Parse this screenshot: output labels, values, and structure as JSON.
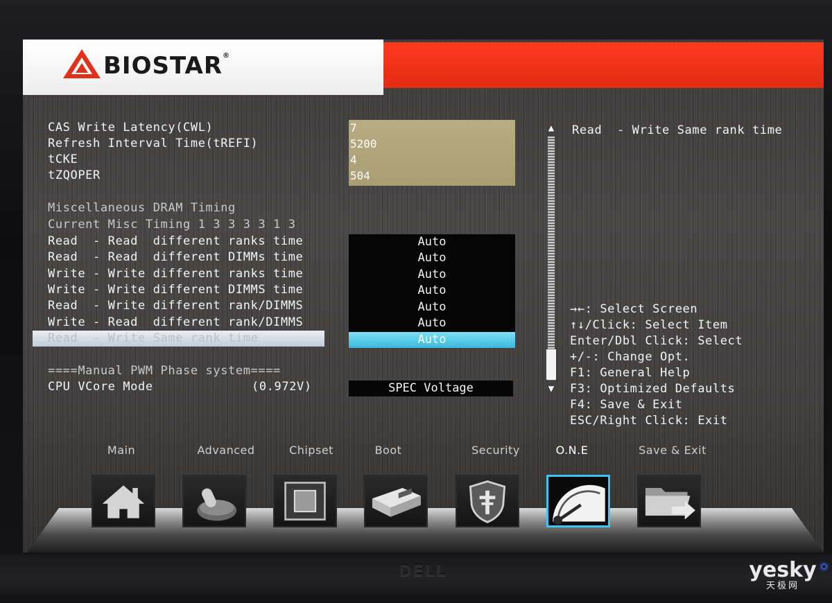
{
  "brand": {
    "logo_text": "BIOSTAR",
    "registered_mark": "®",
    "monitor_brand": "DELL",
    "watermark_main": "yesky",
    "watermark_sub": "天极网"
  },
  "colors": {
    "header_red": "#e92f15",
    "value_panel": "#b0a57a",
    "selection_blue": "#4cc3e4",
    "selection_bar": "#d8dee6",
    "active_tab_border": "#3ec3f2"
  },
  "settings": {
    "top_items": [
      {
        "label": "CAS Write Latency(CWL)",
        "value": "7"
      },
      {
        "label": "Refresh Interval Time(tREFI)",
        "value": "5200"
      },
      {
        "label": "tCKE",
        "value": "4"
      },
      {
        "label": "tZQOPER",
        "value": "504"
      }
    ],
    "misc_section_title": "Miscellaneous DRAM Timing",
    "current_misc": "Current Misc Timing 1 3 3 3 3 1 3",
    "misc_items": [
      {
        "label": "Read  - Read  different ranks time",
        "value": "Auto"
      },
      {
        "label": "Read  - Read  different DIMMs time",
        "value": "Auto"
      },
      {
        "label": "Write - Write different ranks time",
        "value": "Auto"
      },
      {
        "label": "Write - Write different DIMMS time",
        "value": "Auto"
      },
      {
        "label": "Read  - Write different rank/DIMMS",
        "value": "Auto"
      },
      {
        "label": "Write - Read  different rank/DIMMS",
        "value": "Auto"
      },
      {
        "label": "Read  - Write Same rank time",
        "value": "Auto"
      }
    ],
    "selected_index": 6,
    "pwm_section_title": "====Manual PWM Phase system====",
    "vcore": {
      "label": "CPU VCore Mode",
      "reading": "(0.972V)",
      "value": "SPEC Voltage"
    }
  },
  "help": {
    "description": "Read  - Write Same rank time",
    "keys": [
      {
        "glyph": "→←",
        "text": ": Select Screen"
      },
      {
        "glyph": "↑↓",
        "text": "/Click: Select Item"
      },
      {
        "glyph": "",
        "text": "Enter/Dbl Click: Select"
      },
      {
        "glyph": "",
        "text": "+/-: Change Opt."
      },
      {
        "glyph": "",
        "text": "F1: General Help"
      },
      {
        "glyph": "",
        "text": "F3: Optimized Defaults"
      },
      {
        "glyph": "",
        "text": "F4: Save & Exit"
      },
      {
        "glyph": "",
        "text": "ESC/Right Click: Exit"
      }
    ]
  },
  "scrollbar": {
    "up_arrow": "▲",
    "down_arrow": "▼"
  },
  "tabs": [
    {
      "label": "Main",
      "icon": "home-icon"
    },
    {
      "label": "Advanced",
      "icon": "joystick-icon"
    },
    {
      "label": "Chipset",
      "icon": "chip-icon"
    },
    {
      "label": "Boot",
      "icon": "drive-icon"
    },
    {
      "label": "Security",
      "icon": "shield-icon"
    },
    {
      "label": "O.N.E",
      "icon": "speedometer-icon"
    },
    {
      "label": "Save & Exit",
      "icon": "folder-exit-icon"
    }
  ],
  "active_tab": "O.N.E"
}
